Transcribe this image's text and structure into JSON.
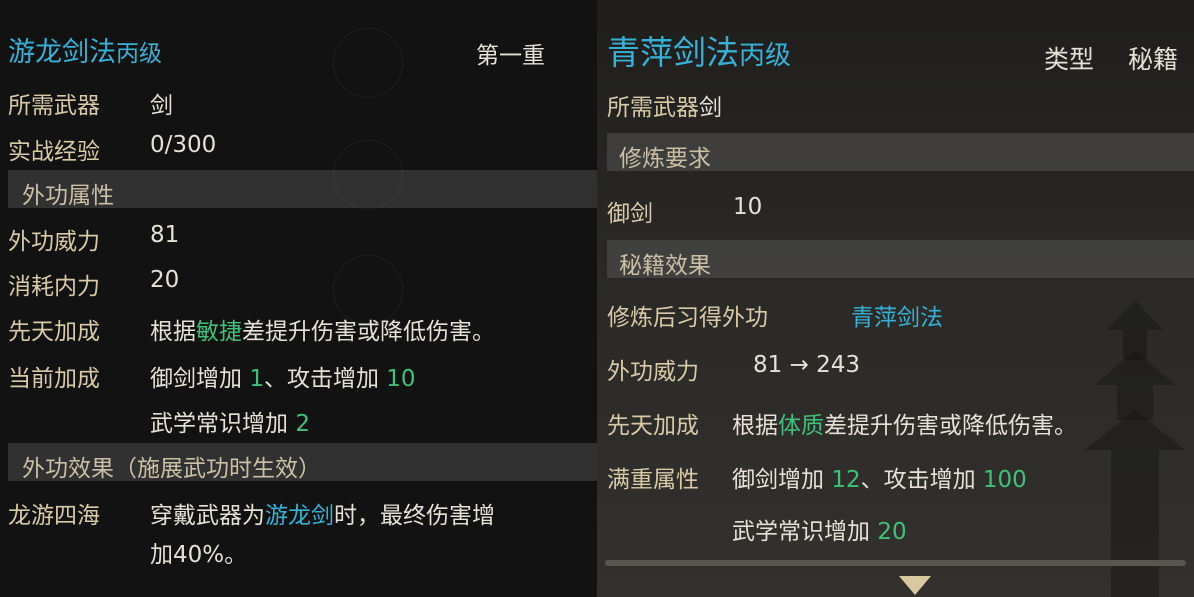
{
  "left": {
    "title": "游龙剑法",
    "grade": "丙级",
    "level": "第一重",
    "weapon_label": "所需武器",
    "weapon_value": "剑",
    "exp_label": "实战经验",
    "exp_value": "0/300",
    "section_attr": "外功属性",
    "power_label": "外功威力",
    "power_value": "81",
    "cost_label": "消耗内力",
    "cost_value": "20",
    "innate_label": "先天加成",
    "innate_pre": "根据",
    "innate_attr": "敏捷",
    "innate_post": "差提升伤害或降低伤害。",
    "current_label": "当前加成",
    "current_a": "御剑增加 ",
    "current_a_val": "1",
    "current_b": "、攻击增加 ",
    "current_b_val": "10",
    "current_c": "武学常识增加 ",
    "current_c_val": "2",
    "section_effect": "外功效果（施展武功时生效）",
    "effect_name": "龙游四海",
    "effect_pre": "穿戴武器为",
    "effect_weapon": "游龙剑",
    "effect_post": "时，最终伤害增",
    "effect_line2": "加40%。"
  },
  "right": {
    "title": "青萍剑法",
    "grade": "丙级",
    "type_label": "类型",
    "type_value": "秘籍",
    "weapon_label": "所需武器",
    "weapon_value": "剑",
    "section_req": "修炼要求",
    "req_label": "御剑",
    "req_value": "10",
    "section_effect": "秘籍效果",
    "learn_label": "修炼后习得外功",
    "learn_value": "青萍剑法",
    "power_label": "外功威力",
    "power_value": "81 → 243",
    "innate_label": "先天加成",
    "innate_pre": "根据",
    "innate_attr": "体质",
    "innate_post": "差提升伤害或降低伤害。",
    "full_label": "满重属性",
    "full_a": "御剑增加 ",
    "full_a_val": "12",
    "full_b": "、攻击增加 ",
    "full_b_val": "100",
    "full_c": "武学常识增加 ",
    "full_c_val": "20"
  },
  "colors": {
    "title_blue": "#36b2d8",
    "bonus_green": "#3ec27a",
    "label_gold": "#d8c9a8"
  }
}
